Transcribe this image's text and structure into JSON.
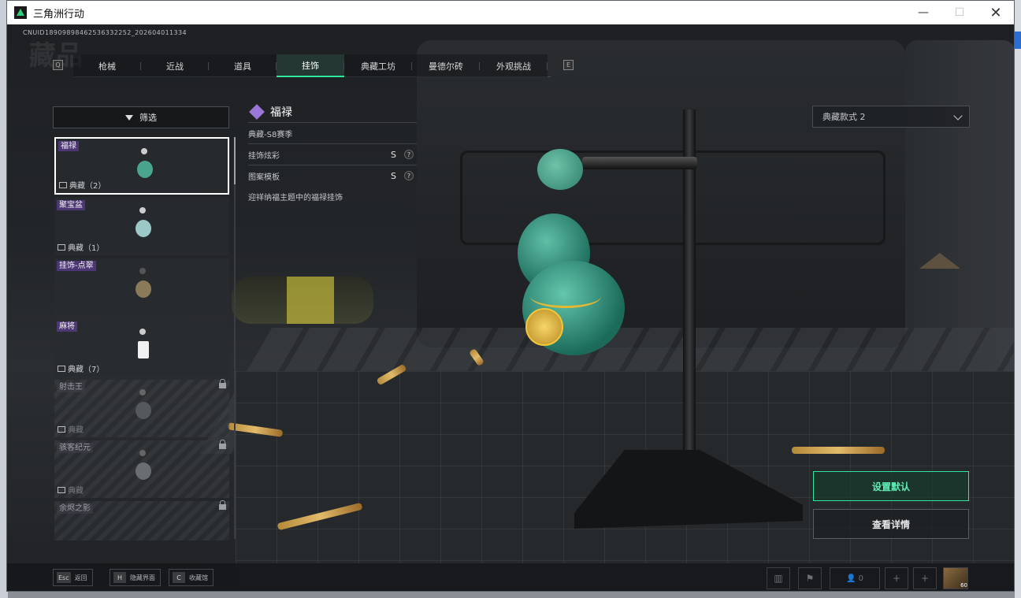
{
  "window": {
    "title": "三角洲行动"
  },
  "cnuid": "CNUID18909898462536332252_202604011334",
  "watermark_title": "藏品",
  "tabs": [
    {
      "label": "枪械"
    },
    {
      "label": "近战"
    },
    {
      "label": "道具"
    },
    {
      "label": "挂饰",
      "active": true
    },
    {
      "label": "典藏工坊"
    },
    {
      "label": "曼德尔砖"
    },
    {
      "label": "外观挑战"
    }
  ],
  "tab_keys": {
    "prev": "Q",
    "next": "E"
  },
  "filter": {
    "label": "筛选"
  },
  "items": [
    {
      "name": "福禄",
      "tag": "典藏（2）",
      "selected": true,
      "locked": false
    },
    {
      "name": "聚宝盆",
      "tag": "典藏（1）",
      "selected": false,
      "locked": false
    },
    {
      "name": "挂饰-点翠",
      "tag": "",
      "selected": false,
      "locked": false
    },
    {
      "name": "麻将",
      "tag": "典藏（7）",
      "selected": false,
      "locked": false
    },
    {
      "name": "射击王",
      "tag": "典藏",
      "selected": false,
      "locked": true
    },
    {
      "name": "骇客纪元",
      "tag": "典藏",
      "selected": false,
      "locked": true
    },
    {
      "name": "余烬之影",
      "tag": "",
      "selected": false,
      "locked": true
    }
  ],
  "detail": {
    "title": "福禄",
    "season": "典藏-S8赛季",
    "rows": [
      {
        "label": "挂饰炫彩",
        "grade": "S",
        "help": "?"
      },
      {
        "label": "图案模板",
        "grade": "S",
        "help": "?"
      }
    ],
    "description": "迎祥纳福主题中的福禄挂饰"
  },
  "variant_select": {
    "value": "典藏款式 2"
  },
  "actions": {
    "set_default": "设置默认",
    "view_details": "查看详情"
  },
  "hints": [
    {
      "key": "Esc",
      "label": "返回"
    },
    {
      "key": "H",
      "label": "隐藏界面"
    },
    {
      "key": "C",
      "label": "收藏馆"
    }
  ],
  "corner": {
    "team_count": "0",
    "avatar_level": "60"
  },
  "colors": {
    "accent": "#2ee8a0",
    "rarity_purple": "#9a76d8"
  }
}
